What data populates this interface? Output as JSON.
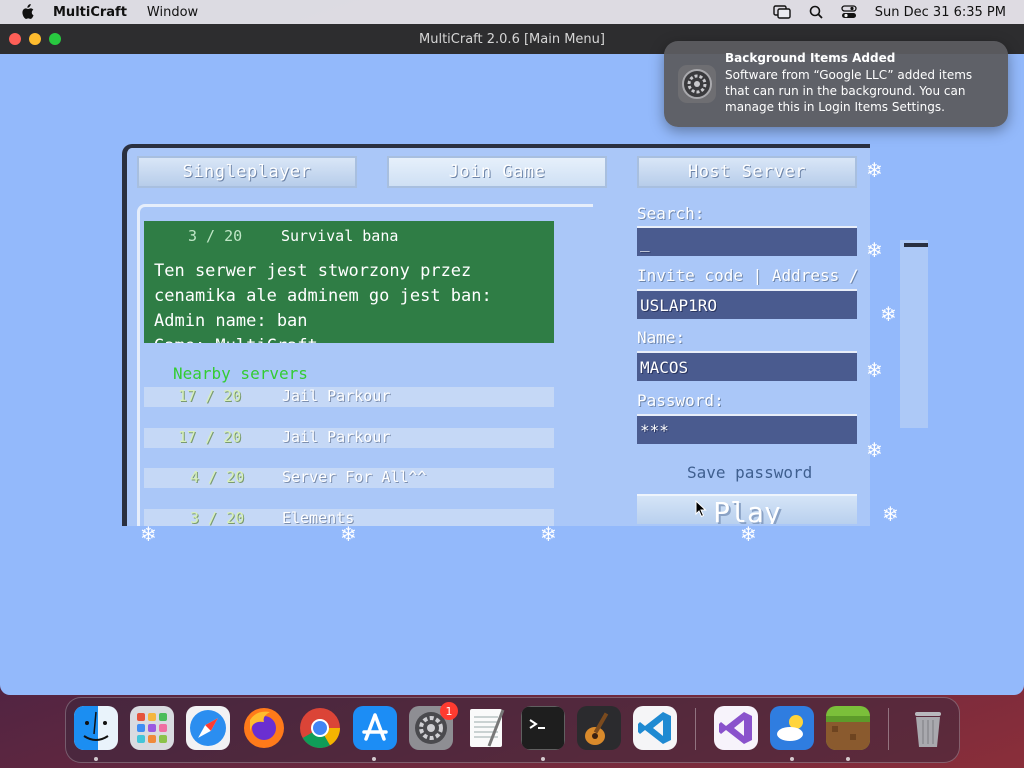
{
  "menubar": {
    "app_name": "MultiCraft",
    "menu_window": "Window",
    "clock": "Sun Dec 31  6:35 PM"
  },
  "window": {
    "title": "MultiCraft 2.0.6 [Main Menu]"
  },
  "tabs": {
    "singleplayer": "Singleplayer",
    "join_game": "Join Game",
    "host_server": "Host Server"
  },
  "selected_server": {
    "count": "3 / 20",
    "name": "Survival bana",
    "description": "Ten serwer jest stworzony przez\ncenamika ale adminem go jest ban:\nAdmin name: ban\nGame: MultiCraft"
  },
  "nearby": {
    "label": "Nearby servers",
    "rows": [
      {
        "count": "17 / 20",
        "name": "Jail Parkour"
      },
      {
        "count": "17 / 20",
        "name": "Jail Parkour"
      },
      {
        "count": "4 / 20",
        "name": "Server For All^^"
      },
      {
        "count": "3 / 20",
        "name": "Elements"
      }
    ]
  },
  "form": {
    "search_label": "Search:",
    "search_value": "_",
    "address_label": "Invite code | Address /",
    "address_value": "USLAP1RO",
    "name_label": "Name:",
    "name_value": "MACOS",
    "password_label": "Password:",
    "password_value": "***",
    "save_password": "Save password",
    "play": "Play"
  },
  "notification": {
    "title": "Background Items Added",
    "body": "Software from “Google LLC” added items that can run in the background. You can manage this in Login Items Settings."
  },
  "dock": {
    "apps": [
      "finder-icon",
      "launchpad-icon",
      "safari-icon",
      "firefox-icon",
      "chrome-icon",
      "app-store-icon",
      "system-settings-icon",
      "textedit-icon",
      "terminal-icon",
      "garageband-icon",
      "vscode-icon",
      "visual-studio-icon",
      "weather-icon",
      "multicraft-icon",
      "trash-icon"
    ],
    "settings_badge": "1"
  },
  "colors": {
    "window_bg": "#93b9fb",
    "selected_server_bg": "#2f7d45",
    "input_bg": "#4a5b8f",
    "nearby_label": "#33cc33"
  }
}
